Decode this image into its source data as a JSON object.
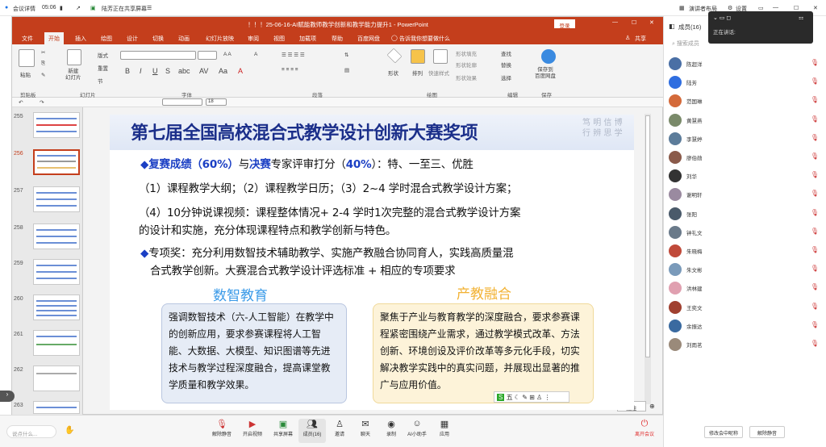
{
  "meeting": {
    "app_label": "会议详情",
    "time": "05:06",
    "sharing": "陆芳正在共享屏幕",
    "top_right": [
      "演讲者布局",
      "设置"
    ],
    "popup_label": "正在讲话:"
  },
  "ppt": {
    "title": "！！！25-06-16-AI赋能教师教学创新和教学能力提升1 - PowerPoint",
    "login": "登录",
    "menus": [
      "文件",
      "开始",
      "插入",
      "绘图",
      "设计",
      "切换",
      "动画",
      "幻灯片放映",
      "审阅",
      "视图",
      "加载项",
      "帮助",
      "百度网盘",
      "告诉我你想要做什么",
      "共享"
    ],
    "ribbon": {
      "paste": "粘贴",
      "new_slide": "新建\n幻灯片",
      "layout": "版式",
      "reset": "重置",
      "section": "节",
      "shape": "形状",
      "arrange": "排列",
      "quick_styles": "快速样式",
      "fill": "形状填充",
      "outline": "形状轮廓",
      "effect": "形状效果",
      "find": "查找",
      "replace": "替换",
      "select": "选择",
      "save_to": "保存到\n百度网盘",
      "groups": [
        "剪贴板",
        "幻灯片",
        "字体",
        "段落",
        "绘图",
        "编辑",
        "保存"
      ],
      "font_size": "18"
    },
    "slide_numbers": [
      "255",
      "256",
      "257",
      "258",
      "259",
      "260",
      "261",
      "262",
      "263"
    ],
    "note_btn": "批注"
  },
  "slide": {
    "title": "第七届全国高校混合式教学设计创新大赛奖项",
    "deco": [
      "笃",
      "行",
      "明",
      "辨",
      "信",
      "思",
      "博",
      "学"
    ],
    "l1": {
      "a": "复赛成绩（60%）",
      "b": "与",
      "c": "决赛",
      "d": "专家评审打分（",
      "e": "40%",
      "f": "）：特、一至三、优胜"
    },
    "l2": "（1）课程教学大纲；（2）课程教学日历；（3）2~4 学时混合式教学设计方案；",
    "l3": "（4）10分钟说课视频：课程整体情况+ 2-4 学时1次完整的混合式教学设计方案",
    "l4": "的设计和实施，充分体现课程特点和教学创新与特色。",
    "l5": "专项奖：充分利用数智技术辅助教学、实施产教融合协同育人，实践高质量混",
    "l6": "合式教学创新。大赛混合式教学设计评选标准 + 相应的专项要求",
    "c1": "数智教育",
    "c2": "产教融合",
    "b1": "强调数智技术（六-人工智能）在教学中的创新应用，要求参赛课程将人工智能、大数据、大模型、知识图谱等先进技术与教学过程深度融合，提高课堂教学质量和教学效果。",
    "b2": "聚焦于产业与教育教学的深度融合，要求参赛课程紧密围绕产业需求，通过教学模式改革、方法创新、环境创设及评价改革等多元化手段，切实解决教学实践中的真实问题，并展现出显著的推广与应用价值。",
    "ime": "五"
  },
  "panel": {
    "title": "成员(16)",
    "search": "搜索成员",
    "members": [
      "陈超洋",
      "陆芳",
      "范国琳",
      "黄慧燕",
      "李慧婷",
      "廖伯勋",
      "刘华",
      "谢明轩",
      "张阳",
      "钟礼文",
      "朱晓梅",
      "朱文彬",
      "洪林建",
      "王奕文",
      "余振达",
      "刘雨茗"
    ],
    "avatar_colors": [
      "#4a6fa5",
      "#2f6ee0",
      "#d46a3a",
      "#7a8a6a",
      "#5c7c9a",
      "#8a5a4a",
      "#333333",
      "#9a8aa0",
      "#4a5a6a",
      "#6a7a8a",
      "#c04a3a",
      "#7a9aba",
      "#e0a0b0",
      "#a04030",
      "#3a6aa0",
      "#9a8a7a"
    ],
    "btn_invite": "修改会中昵称",
    "btn_mute": "解除静音"
  },
  "toolbar": {
    "chat_placeholder": "说点什么...",
    "items": [
      "解除静音",
      "开启视频",
      "共享屏幕",
      "成员(16)",
      "邀请",
      "聊天",
      "录制",
      "AI小助手",
      "应用"
    ],
    "leave": "离开会议"
  }
}
